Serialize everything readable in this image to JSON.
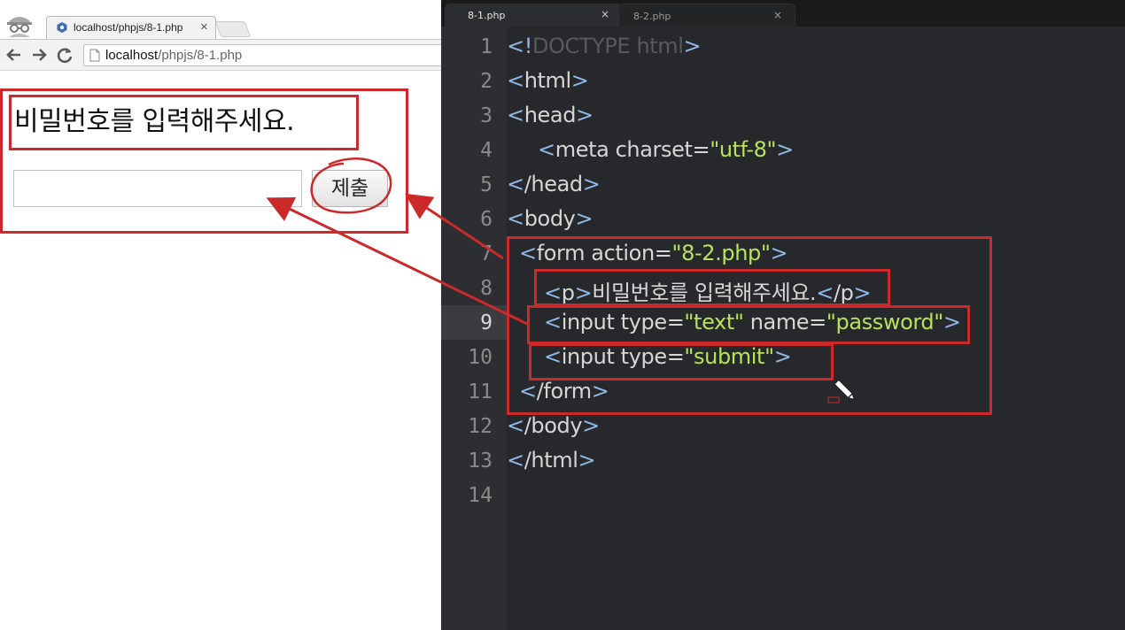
{
  "browser": {
    "tab_title": "localhost/phpjs/8-1.php",
    "tab_close": "×",
    "url_host": "localhost",
    "url_path": "/phpjs/8-1.php",
    "page": {
      "paragraph": "비밀번호를 입력해주세요.",
      "password_value": "",
      "submit_label": "제출"
    }
  },
  "editor": {
    "tabs": [
      {
        "label": "8-1.php",
        "close": "×",
        "active": true
      },
      {
        "label": "8-2.php",
        "close": "×",
        "active": false
      }
    ],
    "current_line": 9,
    "line_numbers": [
      "1",
      "2",
      "3",
      "4",
      "5",
      "6",
      "7",
      "8",
      "9",
      "10",
      "11",
      "12",
      "13",
      "14"
    ],
    "code": {
      "l1_open": "<!",
      "l1_doctype": "DOCTYPE html",
      "l1_close": ">",
      "l2": "html",
      "l3": "head",
      "l4_tag": "meta charset",
      "l4_val": "\"utf-8\"",
      "l5": "/head",
      "l6": "body",
      "l7_tag": "form action",
      "l7_val": "\"8-2.php\"",
      "l8_p": "p",
      "l8_text": "비밀번호를 입력해주세요.",
      "l8_endp": "/p",
      "l9_tag": "input type",
      "l9_val1": "\"text\"",
      "l9_attr2": " name",
      "l9_val2": "\"password\"",
      "l10_tag": "input type",
      "l10_val": "\"submit\"",
      "l11": "/form",
      "l12": "/body",
      "l13": "/html"
    }
  },
  "colors": {
    "annotation_red": "#cc2a2a",
    "string_green": "#b6e35a",
    "bracket_blue": "#8fb8e8"
  },
  "icons": [
    "incognito-icon",
    "favicon-icon",
    "back-arrow-icon",
    "forward-arrow-icon",
    "reload-icon",
    "page-icon",
    "mouse-cursor-icon"
  ]
}
